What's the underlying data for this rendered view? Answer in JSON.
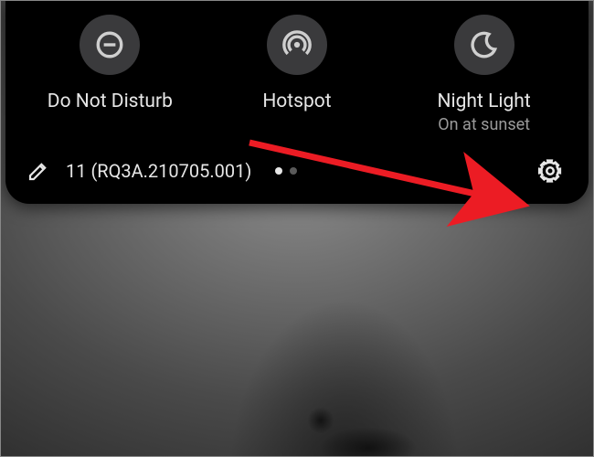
{
  "tiles": [
    {
      "label": "Do Not Disturb",
      "sub": ""
    },
    {
      "label": "Hotspot",
      "sub": ""
    },
    {
      "label": "Night Light",
      "sub": "On at sunset"
    }
  ],
  "footer": {
    "build": "11 (RQ3A.210705.001)"
  },
  "pager": {
    "count": 2,
    "active": 0
  },
  "colors": {
    "accent_arrow": "#ec1c24"
  }
}
